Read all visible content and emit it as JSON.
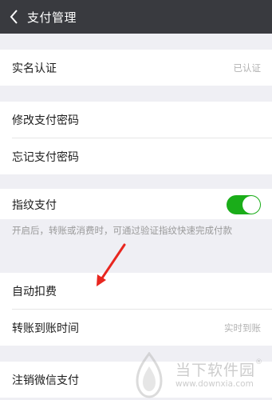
{
  "header": {
    "title": "支付管理",
    "back_icon": "back-arrow-icon"
  },
  "groups": {
    "identity": {
      "label": "实名认证",
      "value": "已认证"
    },
    "password": {
      "change_label": "修改支付密码",
      "forgot_label": "忘记支付密码"
    },
    "fingerprint": {
      "label": "指纹支付",
      "enabled": true,
      "note": "开启后，转账或消费时，可通过验证指纹快速完成付款"
    },
    "auto": {
      "auto_debit_label": "自动扣费",
      "transfer_label": "转账到账时间",
      "transfer_value": "实时到账"
    },
    "cancel": {
      "label": "注销微信支付"
    }
  },
  "watermark": {
    "text": "当下软件园",
    "reg": "®",
    "url": "www.downxia.com"
  },
  "colors": {
    "titlebar": "#393a3f",
    "toggle_on": "#1aad19",
    "background": "#efeff4",
    "annotation_arrow": "#e8261f"
  }
}
